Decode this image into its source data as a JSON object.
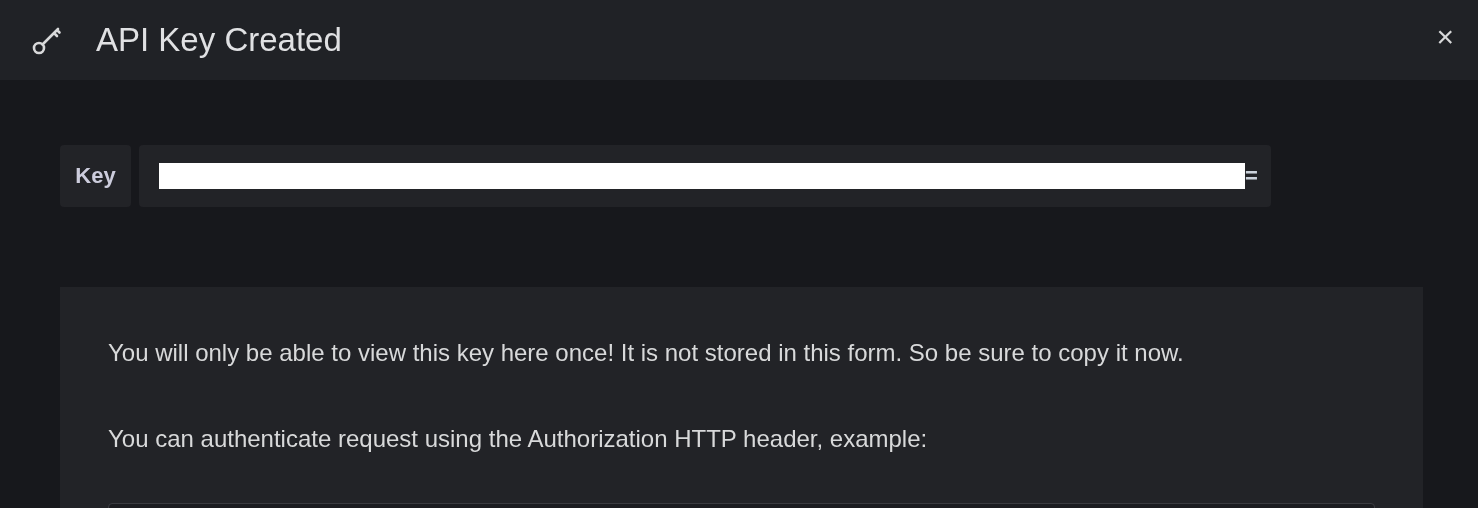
{
  "window": {
    "title": "API Key Created",
    "close": "×"
  },
  "key_field": {
    "label": "Key",
    "redacted": true,
    "visible_end": "="
  },
  "info": {
    "paragraphs": [
      "You will only be able to view this key here once! It is not stored in this form. So be sure to copy it now.",
      "You can authenticate request using the Authorization HTTP header, example:"
    ],
    "code_block": {
      "kind": "code"
    }
  }
}
